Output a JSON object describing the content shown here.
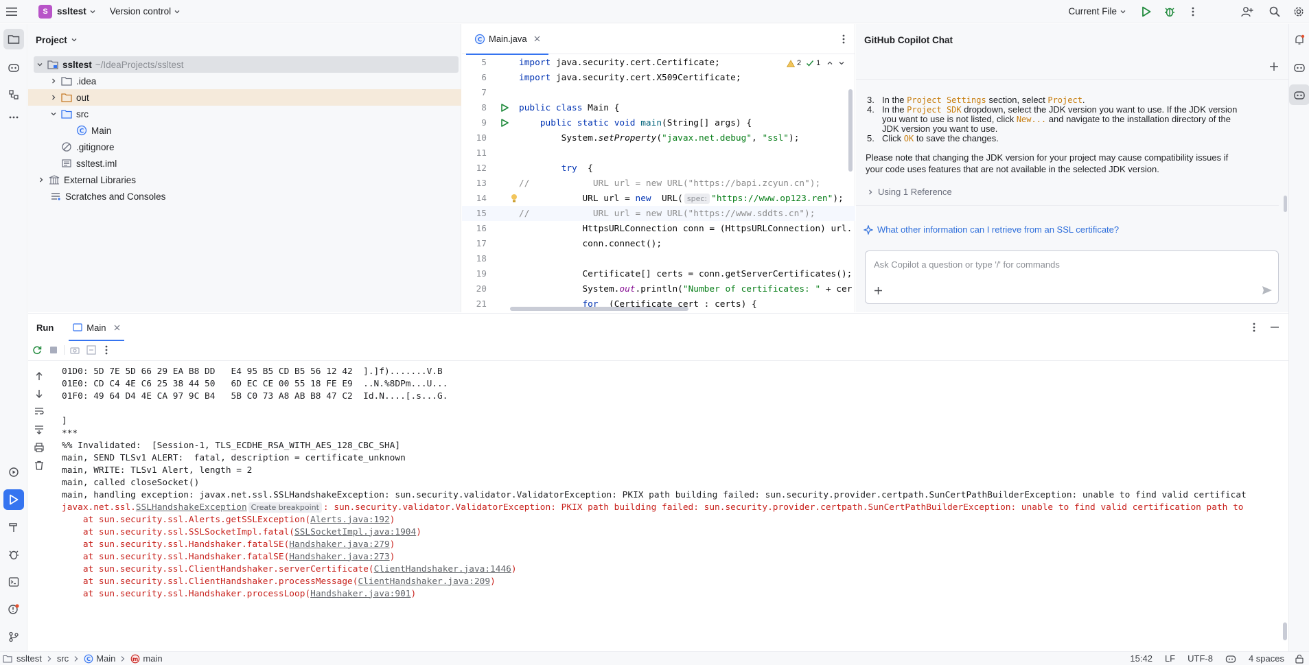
{
  "titlebar": {
    "project_badge": "S",
    "project_name": "ssltest",
    "vcs": "Version control",
    "run_config": "Current File",
    "icons": [
      "hamburger-icon",
      "run-icon",
      "debug-icon",
      "more-icon",
      "add-user-icon",
      "search-icon",
      "gear-icon"
    ]
  },
  "project_panel": {
    "title": "Project",
    "tree": [
      {
        "name": "ssltest",
        "suffix": "~/IdeaProjects/ssltest",
        "depth": 0,
        "expanded": true,
        "icon": "folder-module-icon"
      },
      {
        "name": ".idea",
        "depth": 1,
        "expanded": false,
        "icon": "folder-icon"
      },
      {
        "name": "out",
        "depth": 1,
        "expanded": false,
        "icon": "folder-excluded-icon"
      },
      {
        "name": "src",
        "depth": 1,
        "expanded": true,
        "icon": "folder-source-icon"
      },
      {
        "name": "Main",
        "depth": 2,
        "icon": "class-icon"
      },
      {
        "name": ".gitignore",
        "depth": 1,
        "icon": "ignore-file-icon"
      },
      {
        "name": "ssltest.iml",
        "depth": 1,
        "icon": "iml-file-icon"
      },
      {
        "name": "External Libraries",
        "depth": 0,
        "expanded": false,
        "icon": "libraries-icon"
      },
      {
        "name": "Scratches and Consoles",
        "depth": 0,
        "icon": "scratches-icon"
      }
    ]
  },
  "editor": {
    "tab": "Main.java",
    "inspection": {
      "warnings": "2",
      "checks": "1"
    },
    "current_line": "15",
    "lines": [
      {
        "n": "5",
        "segments": [
          [
            "kw",
            "import"
          ],
          [
            "",
            "java.security.cert.Certificate;"
          ]
        ]
      },
      {
        "n": "6",
        "segments": [
          [
            "kw",
            "import"
          ],
          [
            "",
            "java.security.cert.X509Certificate;"
          ]
        ]
      },
      {
        "n": "7",
        "segments": []
      },
      {
        "n": "8",
        "segments": [
          [
            "kw",
            "public class"
          ],
          [
            "",
            "Main {"
          ]
        ]
      },
      {
        "n": "9",
        "segments": [
          [
            "",
            "    "
          ],
          [
            "kw",
            "public static void"
          ],
          [
            "fn",
            "main"
          ],
          [
            "",
            "(String[] args) {"
          ]
        ]
      },
      {
        "n": "10",
        "segments": [
          [
            "",
            "        System."
          ],
          [
            "it",
            "setProperty"
          ],
          [
            "",
            "("
          ],
          [
            "str",
            "\"javax.net.debug\""
          ],
          [
            "",
            ", "
          ],
          [
            "str",
            "\"ssl\""
          ],
          [
            "",
            ");"
          ]
        ]
      },
      {
        "n": "11",
        "segments": []
      },
      {
        "n": "12",
        "segments": [
          [
            "",
            "        "
          ],
          [
            "kw",
            "try"
          ],
          [
            "",
            " {"
          ]
        ]
      },
      {
        "n": "13",
        "segments": [
          [
            "cmt",
            "//            URL url = new URL(\"https://bapi.zcyun.cn\");"
          ]
        ]
      },
      {
        "n": "14",
        "segments": [
          [
            "",
            "            URL url = "
          ],
          [
            "kw",
            "new"
          ],
          [
            "",
            " URL("
          ],
          [
            "hint",
            "spec:"
          ],
          [
            "str",
            "\"https://www.op123.ren\""
          ],
          [
            "",
            ");"
          ]
        ]
      },
      {
        "n": "15",
        "segments": [
          [
            "cmt",
            "//            URL url = new URL(\"https://www.sddts.cn\");"
          ]
        ]
      },
      {
        "n": "16",
        "segments": [
          [
            "",
            "            HttpsURLConnection conn = (HttpsURLConnection) url."
          ]
        ]
      },
      {
        "n": "17",
        "segments": [
          [
            "",
            "            conn.connect();"
          ]
        ]
      },
      {
        "n": "18",
        "segments": []
      },
      {
        "n": "19",
        "segments": [
          [
            "",
            "            Certificate[] certs = conn.getServerCertificates();"
          ]
        ]
      },
      {
        "n": "20",
        "segments": [
          [
            "",
            "            System."
          ],
          [
            "purple",
            "out"
          ],
          [
            "",
            ".println("
          ],
          [
            "str",
            "\"Number of certificates: \""
          ],
          [
            "",
            " + cer"
          ]
        ]
      },
      {
        "n": "21",
        "segments": [
          [
            "",
            "            "
          ],
          [
            "kw",
            "for"
          ],
          [
            "",
            " (Certificate cert : certs) {"
          ]
        ]
      }
    ]
  },
  "copilot": {
    "title": "GitHub Copilot Chat",
    "steps": [
      {
        "num": "3.",
        "parts": [
          [
            "",
            "In the "
          ],
          [
            "code",
            "Project Settings"
          ],
          [
            "",
            " section, select "
          ],
          [
            "code2",
            "Project"
          ],
          [
            "",
            "."
          ]
        ]
      },
      {
        "num": "4.",
        "parts": [
          [
            "",
            "In the "
          ],
          [
            "code",
            "Project SDK"
          ],
          [
            "",
            " dropdown, select the JDK version you want to use. If the JDK version"
          ]
        ]
      },
      {
        "num": "",
        "parts": [
          [
            "",
            "you want to use is not listed, click "
          ],
          [
            "code",
            "New..."
          ],
          [
            "",
            " and navigate to the installation directory of the"
          ]
        ]
      },
      {
        "num": "",
        "parts": [
          [
            "",
            "JDK version you want to use."
          ]
        ]
      },
      {
        "num": "5.",
        "parts": [
          [
            "",
            "Click "
          ],
          [
            "code",
            "OK"
          ],
          [
            "",
            " to save the changes."
          ]
        ]
      }
    ],
    "note_line1": "Please note that changing the JDK version for your project may cause compatibility issues if",
    "note_line2": "your code uses features that are not available in the selected JDK version.",
    "reference": "Using 1 Reference",
    "suggestion": "What other information can I retrieve from an SSL certificate?",
    "input_placeholder": "Ask Copilot a question or type '/' for commands"
  },
  "run_panel": {
    "tab_run": "Run",
    "tab_main": "Main",
    "output": [
      {
        "t": "01D0: 5D 7E 5D 66 29 EA B8 DD   E4 95 B5 CD B5 56 12 42  ].]f).......V.B",
        "k": "n"
      },
      {
        "t": "01E0: CD C4 4E C6 25 38 44 50   6D EC CE 00 55 18 FE E9  ..N.%8DPm...U...",
        "k": "n"
      },
      {
        "t": "01F0: 49 64 D4 4E CA 97 9C B4   5B C0 73 A8 AB B8 47 C2  Id.N....[.s...G.",
        "k": "n"
      },
      {
        "t": "",
        "k": "n"
      },
      {
        "t": "]",
        "k": "n"
      },
      {
        "t": "***",
        "k": "n"
      },
      {
        "t": "%% Invalidated:  [Session-1, TLS_ECDHE_RSA_WITH_AES_128_CBC_SHA]",
        "k": "n"
      },
      {
        "t": "main, SEND TLSv1 ALERT:  fatal, description = certificate_unknown",
        "k": "n"
      },
      {
        "t": "main, WRITE: TLSv1 Alert, length = 2",
        "k": "n"
      },
      {
        "t": "main, called closeSocket()",
        "k": "n"
      },
      {
        "t": "main, handling exception: javax.net.ssl.SSLHandshakeException: sun.security.validator.ValidatorException: PKIX path building failed: sun.security.provider.certpath.SunCertPathBuilderException: unable to find valid certificat",
        "k": "n"
      }
    ],
    "exception": {
      "prefix": "javax.net.ssl.",
      "link": "SSLHandshakeException",
      "badge": "Create breakpoint",
      "rest": ": sun.security.validator.ValidatorException: PKIX path building failed: sun.security.provider.certpath.SunCertPathBuilderException: unable to find valid certification path to"
    },
    "stack": [
      {
        "at": "    at sun.security.ssl.Alerts.getSSLException(",
        "link": "Alerts.java:192",
        "end": ")"
      },
      {
        "at": "    at sun.security.ssl.SSLSocketImpl.fatal(",
        "link": "SSLSocketImpl.java:1904",
        "end": ")"
      },
      {
        "at": "    at sun.security.ssl.Handshaker.fatalSE(",
        "link": "Handshaker.java:279",
        "end": ")"
      },
      {
        "at": "    at sun.security.ssl.Handshaker.fatalSE(",
        "link": "Handshaker.java:273",
        "end": ")"
      },
      {
        "at": "    at sun.security.ssl.ClientHandshaker.serverCertificate(",
        "link": "ClientHandshaker.java:1446",
        "end": ")"
      },
      {
        "at": "    at sun.security.ssl.ClientHandshaker.processMessage(",
        "link": "ClientHandshaker.java:209",
        "end": ")"
      },
      {
        "at": "    at sun.security.ssl.Handshaker.processLoop(",
        "link": "Handshaker.java:901",
        "end": ")"
      }
    ]
  },
  "statusbar": {
    "breadcrumb": [
      "ssltest",
      "src",
      "Main",
      "main"
    ],
    "position": "15:42",
    "line_sep": "LF",
    "encoding": "UTF-8",
    "indent": "4 spaces"
  },
  "colors": {
    "accent": "#3574f0",
    "error": "#c8211c",
    "keyword": "#0033b3",
    "string": "#067d17"
  }
}
